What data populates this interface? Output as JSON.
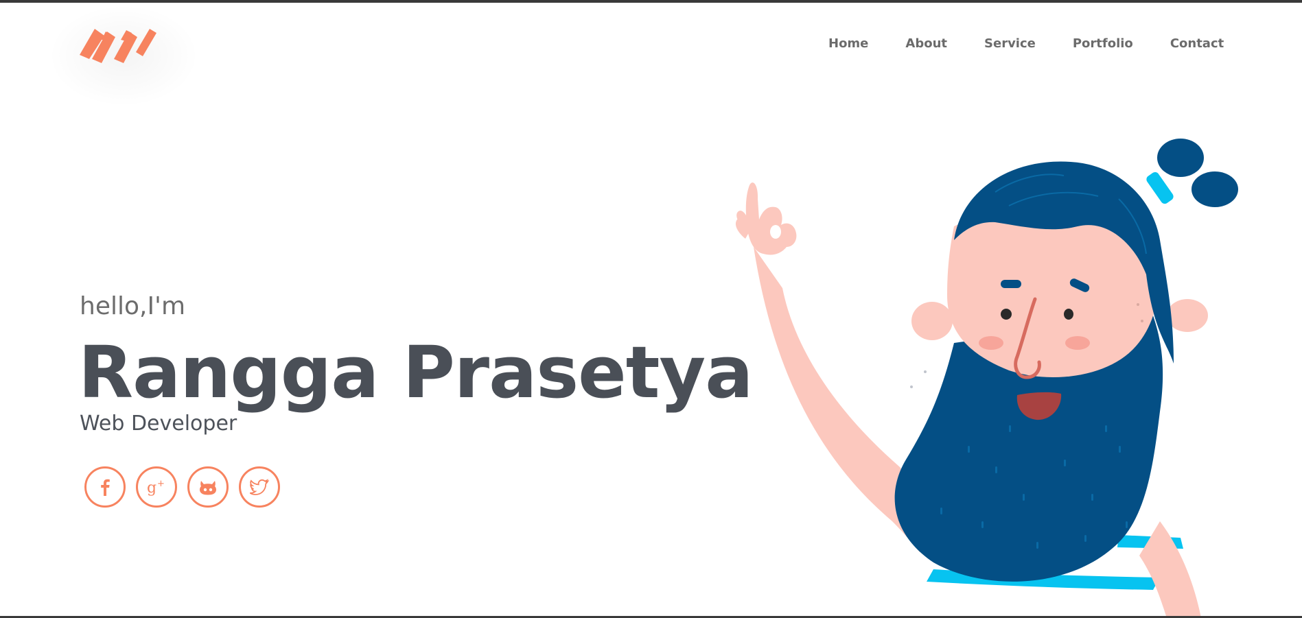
{
  "nav": {
    "items": [
      {
        "label": "Home"
      },
      {
        "label": "About"
      },
      {
        "label": "Service"
      },
      {
        "label": "Portfolio"
      },
      {
        "label": "Contact"
      }
    ]
  },
  "hero": {
    "greeting": "hello,I'm",
    "name": "Rangga Prasetya",
    "role": "Web Developer"
  },
  "socials": [
    {
      "icon": "facebook-icon",
      "glyph": "f"
    },
    {
      "icon": "google-plus-icon",
      "glyph": "g+"
    },
    {
      "icon": "github-icon",
      "glyph": "cat"
    },
    {
      "icon": "twitter-icon",
      "glyph": "bird"
    }
  ],
  "colors": {
    "accent": "#f7835f",
    "heading": "#4a4f57",
    "nav": "#6b6b6b",
    "beard": "#044f85",
    "skin": "#fcc8be",
    "stripe": "#07c3f0"
  }
}
